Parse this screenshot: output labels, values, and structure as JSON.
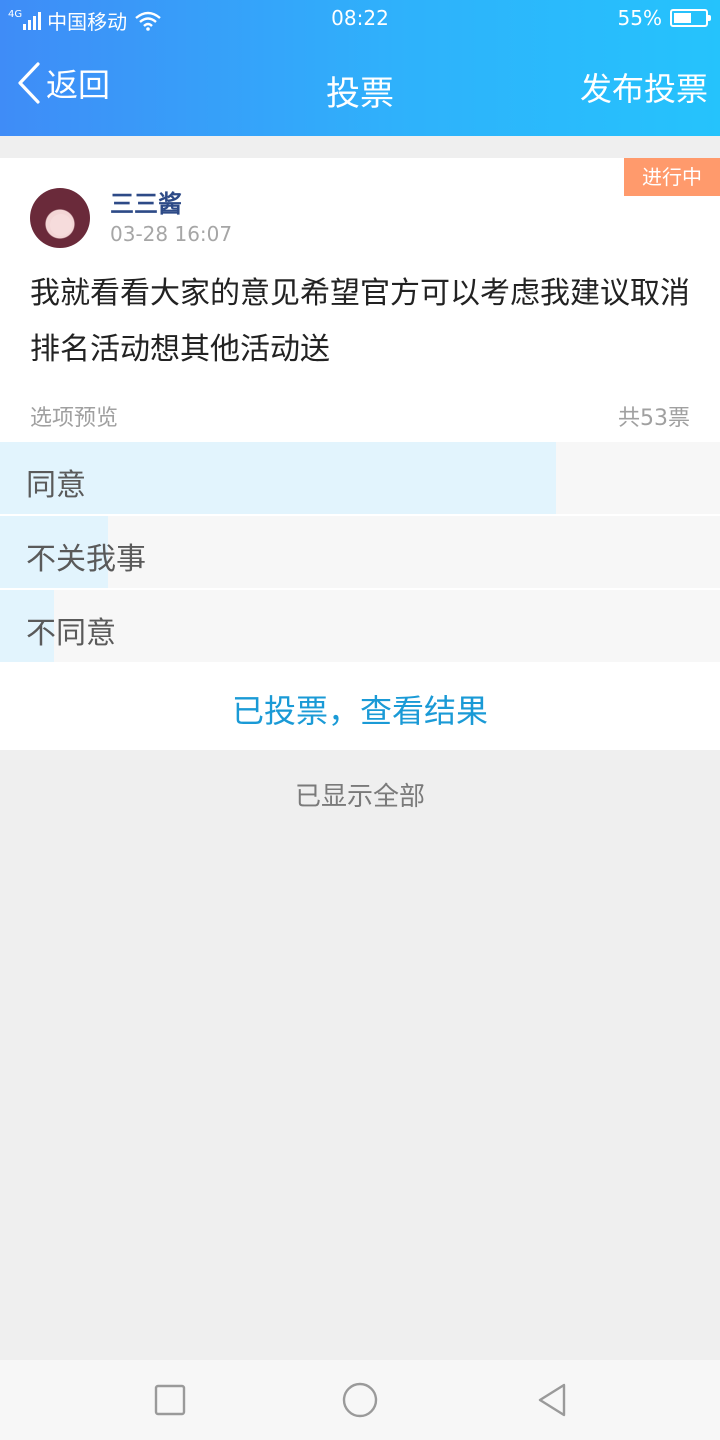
{
  "status_bar": {
    "network": "4G",
    "carrier": "中国移动",
    "time": "08:22",
    "battery_percent": "55%",
    "battery_level": 0.55,
    "icons": [
      "signal-icon",
      "wifi-icon",
      "battery-icon"
    ]
  },
  "nav": {
    "back_label": "返回",
    "title": "投票",
    "action_label": "发布投票"
  },
  "post": {
    "status_tag": "进行中",
    "username": "三三酱",
    "time": "03-28 16:07",
    "content": "我就看看大家的意见希望官方可以考虑我建议取消排名活动想其他活动送",
    "options_label": "选项预览",
    "total_votes": "共53票",
    "options": [
      {
        "label": "同意",
        "share": 0.772
      },
      {
        "label": "不关我事",
        "share": 0.15
      },
      {
        "label": "不同意",
        "share": 0.075
      }
    ],
    "result_link": "已投票，查看结果"
  },
  "footer_text": "已显示全部",
  "colors": {
    "header_gradient_start": "#3f8cf7",
    "header_gradient_end": "#25c3fc",
    "tag_bg": "#ff9a6c",
    "username": "#2d4a87",
    "link": "#1a9ad6",
    "option_bar": "#e2f4fd"
  }
}
